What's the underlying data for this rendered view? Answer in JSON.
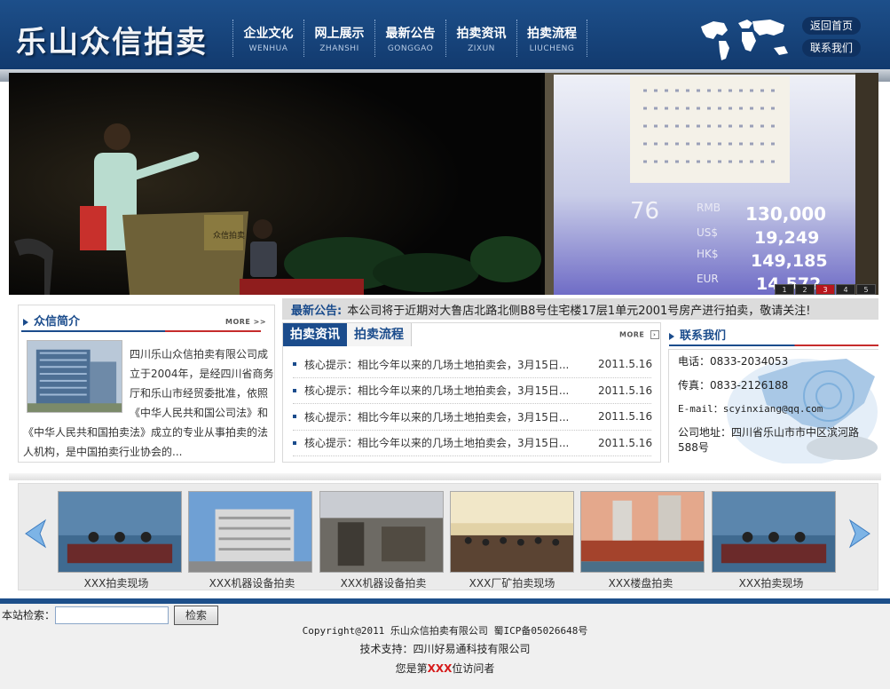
{
  "header": {
    "logo": "乐山众信拍卖",
    "nav": [
      {
        "cn": "企业文化",
        "en": "WENHUA"
      },
      {
        "cn": "网上展示",
        "en": "ZHANSHI"
      },
      {
        "cn": "最新公告",
        "en": "GONGGAO"
      },
      {
        "cn": "拍卖资讯",
        "en": "ZIXUN"
      },
      {
        "cn": "拍卖流程",
        "en": "LIUCHENG"
      }
    ],
    "links": [
      "返回首页",
      "联系我们"
    ]
  },
  "banner": {
    "slides": [
      "1",
      "2",
      "3",
      "4",
      "5"
    ],
    "active_slide": 3,
    "screen_text": {
      "lot": "76",
      "rows": [
        {
          "cur": "RMB",
          "val": "130,000"
        },
        {
          "cur": "US$",
          "val": "19,249"
        },
        {
          "cur": "HK$",
          "val": "149,185"
        },
        {
          "cur": "EUR",
          "val": "14,572"
        }
      ],
      "podium": "众信拍卖"
    }
  },
  "notice": {
    "label": "最新公告:",
    "text": "本公司将于近期对大鲁店北路北侧B8号住宅楼17层1单元2001号房产进行拍卖，敬请关注!"
  },
  "intro": {
    "title": "众信简介",
    "more": "MORE >>",
    "text": "四川乐山众信拍卖有限公司成立于2004年，是经四川省商务厅和乐山市经贸委批准，依照《中华人民共和国公司法》和《中华人民共和国拍卖法》成立的专业从事拍卖的法人机构，是中国拍卖行业协会的..."
  },
  "news": {
    "tabs": [
      "拍卖资讯",
      "拍卖流程"
    ],
    "more": "MORE",
    "items": [
      {
        "title": "核心提示：相比今年以来的几场土地拍卖会，3月15日...",
        "date": "2011.5.16"
      },
      {
        "title": "核心提示：相比今年以来的几场土地拍卖会，3月15日...",
        "date": "2011.5.16"
      },
      {
        "title": "核心提示：相比今年以来的几场土地拍卖会，3月15日...",
        "date": "2011.5.16"
      },
      {
        "title": "核心提示：相比今年以来的几场土地拍卖会，3月15日...",
        "date": "2011.5.16"
      }
    ]
  },
  "contact": {
    "title": "联系我们",
    "phone": "电话：0833-2034053",
    "fax": "传真：0833-2126188",
    "email": "E-mail：scyinxiang@qq.com",
    "address": "公司地址：四川省乐山市市中区滨河路588号"
  },
  "gallery": {
    "items": [
      "XXX拍卖现场",
      "XXX机器设备拍卖",
      "XXX机器设备拍卖",
      "XXX厂矿拍卖现场",
      "XXX楼盘拍卖",
      "XXX拍卖现场"
    ]
  },
  "footer": {
    "search_label": "本站检索：",
    "search_button": "检索",
    "copyright": "Copyright@2011 乐山众信拍卖有限公司 蜀ICP备05026648号",
    "support": "技术支持：四川好易通科技有限公司",
    "visitor_prefix": "您是第",
    "visitor_count": "XXX",
    "visitor_suffix": "位访问者"
  },
  "colors": {
    "brand_blue": "#1b4c8c",
    "accent_red": "#c62c2c"
  }
}
